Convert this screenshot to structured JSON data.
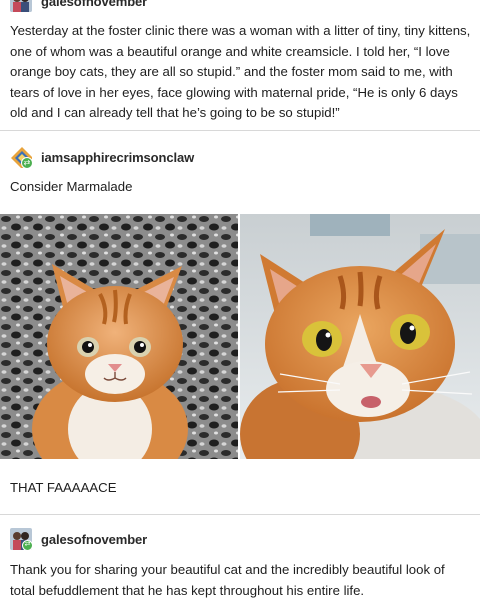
{
  "post1": {
    "username": "galesofnovember",
    "text": "Yesterday at the foster clinic there was a woman with a litter of tiny, tiny kittens, one of whom was a beautiful orange and white creamsicle.  I told her, “I love orange boy cats, they are all so stupid.” and the foster mom said to me, with tears of love in her eyes, face glowing with maternal pride, “He is only 6 days old and I can already tell that he’s going to be so stupid!”"
  },
  "post2": {
    "username": "iamsapphirecrimsonclaw",
    "text": "Consider Marmalade",
    "images": [
      "orange-kitten-photo",
      "orange-cat-photo"
    ]
  },
  "post3": {
    "text": "THAT FAAAAACE"
  },
  "post4": {
    "username": "galesofnovember",
    "text": "Thank you for sharing your beautiful cat and the incredibly beautiful look of total befuddlement that he has kept throughout his entire life."
  },
  "colors": {
    "accent_green": "#4caf50",
    "avatar_orange": "#e8a33c"
  }
}
